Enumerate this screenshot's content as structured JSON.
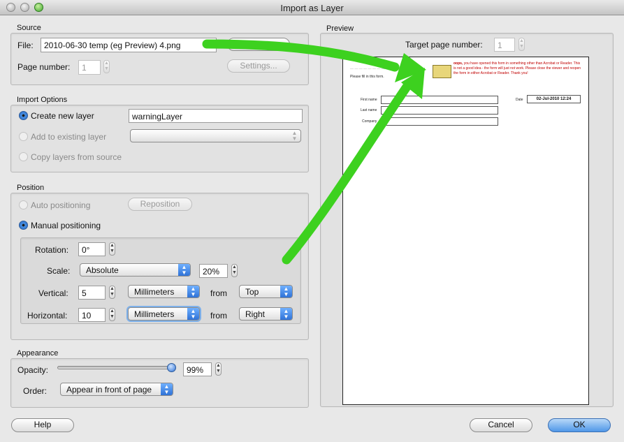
{
  "window": {
    "title": "Import as Layer"
  },
  "source": {
    "section_label": "Source",
    "file_label": "File:",
    "file_value": "2010-06-30 temp (eg Preview) 4.png",
    "browse_label": "Browse...",
    "page_number_label": "Page number:",
    "page_number_value": "1",
    "settings_label": "Settings..."
  },
  "import_options": {
    "section_label": "Import Options",
    "create_new_layer_label": "Create new layer",
    "layer_name_value": "warningLayer",
    "add_to_existing_label": "Add to existing layer",
    "copy_layers_label": "Copy layers from source",
    "selected_option": "Create new layer"
  },
  "position": {
    "section_label": "Position",
    "auto_label": "Auto positioning",
    "reposition_label": "Reposition",
    "manual_label": "Manual positioning",
    "selected_option": "Manual positioning",
    "rotation_label": "Rotation:",
    "rotation_value": "0°",
    "scale_label": "Scale:",
    "scale_mode": "Absolute",
    "scale_value": "20%",
    "vertical_label": "Vertical:",
    "vertical_value": "5",
    "vertical_units": "Millimeters",
    "vertical_from_label": "from",
    "vertical_from": "Top",
    "horizontal_label": "Horizontal:",
    "horizontal_value": "10",
    "horizontal_units": "Millimeters",
    "horizontal_from_label": "from",
    "horizontal_from": "Right"
  },
  "appearance": {
    "section_label": "Appearance",
    "opacity_label": "Opacity:",
    "opacity_value": "99%",
    "opacity_fraction": 0.99,
    "order_label": "Order:",
    "order_value": "Appear in front of page"
  },
  "preview": {
    "section_label": "Preview",
    "target_page_label": "Target page number:",
    "target_page_value": "1",
    "doc": {
      "header_text": "Please fill in this form.",
      "warning_lead": "oops,",
      "warning_text": "you have opened this form in something other than Acrobat or Reader. This is not a good idea - the form will just not work. Please close the viewer and reopen the form in either Acrobat or Reader. Thank you!",
      "first_name_label": "First name",
      "last_name_label": "Last name",
      "company_label": "Company",
      "date_label": "Date",
      "date_value": "02-Jul-2010 12:24"
    }
  },
  "footer": {
    "help_label": "Help",
    "cancel_label": "Cancel",
    "ok_label": "OK"
  },
  "colors": {
    "accent": "#3a7fd8",
    "annotation_arrow": "#3dd11f",
    "warning_text": "#c00000"
  }
}
